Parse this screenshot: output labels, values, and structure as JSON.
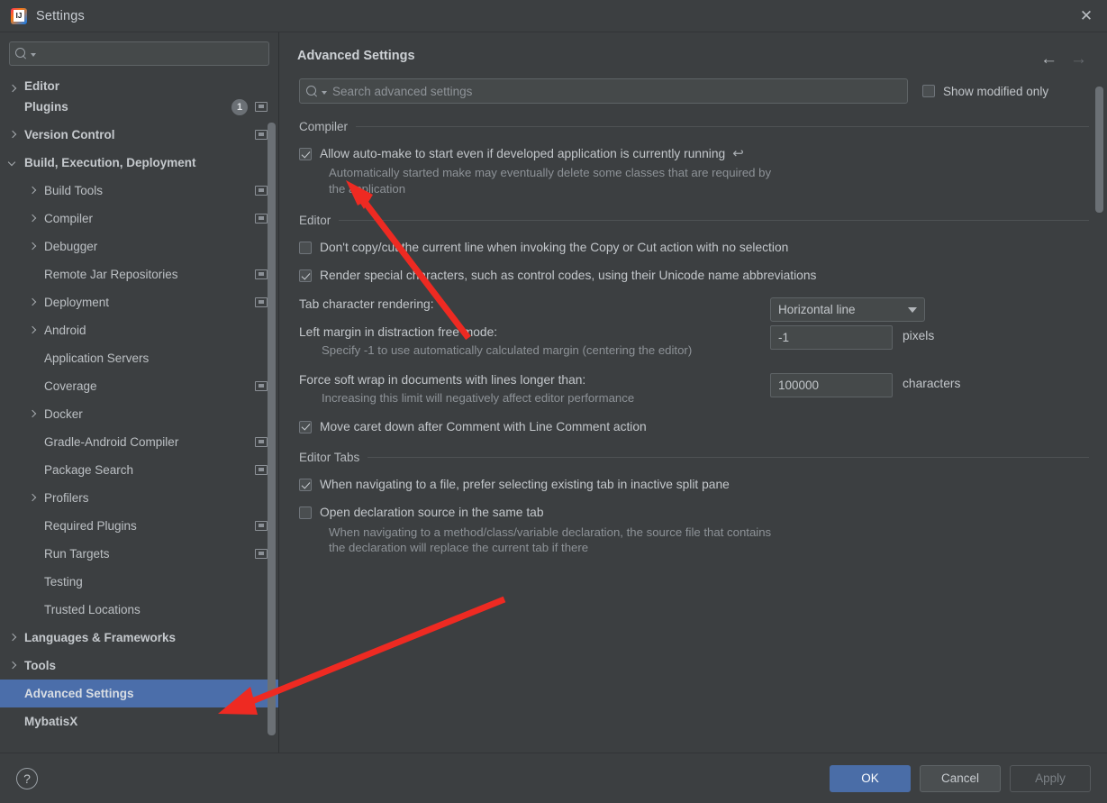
{
  "window": {
    "title": "Settings",
    "app_icon": "intellij-idea-icon",
    "close_icon": "close-icon"
  },
  "sidebar": {
    "search": {
      "placeholder": "",
      "value": "",
      "icon": "search-icon"
    },
    "items": [
      {
        "label": "Editor",
        "arrow": "right",
        "bold": true,
        "clipped": true,
        "badge": "",
        "proj_icon": false,
        "selected": false
      },
      {
        "label": "Plugins",
        "arrow": "none",
        "bold": true,
        "clipped": false,
        "badge": "1",
        "proj_icon": true,
        "selected": false
      },
      {
        "label": "Version Control",
        "arrow": "right",
        "bold": true,
        "clipped": false,
        "badge": "",
        "proj_icon": true,
        "selected": false
      },
      {
        "label": "Build, Execution, Deployment",
        "arrow": "down",
        "bold": true,
        "clipped": false,
        "badge": "",
        "proj_icon": false,
        "selected": false
      },
      {
        "label": "Build Tools",
        "arrow": "right",
        "bold": false,
        "clipped": false,
        "badge": "",
        "proj_icon": true,
        "selected": false,
        "indent": 1
      },
      {
        "label": "Compiler",
        "arrow": "right",
        "bold": false,
        "clipped": false,
        "badge": "",
        "proj_icon": true,
        "selected": false,
        "indent": 1
      },
      {
        "label": "Debugger",
        "arrow": "right",
        "bold": false,
        "clipped": false,
        "badge": "",
        "proj_icon": false,
        "selected": false,
        "indent": 1
      },
      {
        "label": "Remote Jar Repositories",
        "arrow": "none",
        "bold": false,
        "clipped": false,
        "badge": "",
        "proj_icon": true,
        "selected": false,
        "indent": 1
      },
      {
        "label": "Deployment",
        "arrow": "right",
        "bold": false,
        "clipped": false,
        "badge": "",
        "proj_icon": true,
        "selected": false,
        "indent": 1
      },
      {
        "label": "Android",
        "arrow": "right",
        "bold": false,
        "clipped": false,
        "badge": "",
        "proj_icon": false,
        "selected": false,
        "indent": 1
      },
      {
        "label": "Application Servers",
        "arrow": "none",
        "bold": false,
        "clipped": false,
        "badge": "",
        "proj_icon": false,
        "selected": false,
        "indent": 1
      },
      {
        "label": "Coverage",
        "arrow": "none",
        "bold": false,
        "clipped": false,
        "badge": "",
        "proj_icon": true,
        "selected": false,
        "indent": 1
      },
      {
        "label": "Docker",
        "arrow": "right",
        "bold": false,
        "clipped": false,
        "badge": "",
        "proj_icon": false,
        "selected": false,
        "indent": 1
      },
      {
        "label": "Gradle-Android Compiler",
        "arrow": "none",
        "bold": false,
        "clipped": false,
        "badge": "",
        "proj_icon": true,
        "selected": false,
        "indent": 1
      },
      {
        "label": "Package Search",
        "arrow": "none",
        "bold": false,
        "clipped": false,
        "badge": "",
        "proj_icon": true,
        "selected": false,
        "indent": 1
      },
      {
        "label": "Profilers",
        "arrow": "right",
        "bold": false,
        "clipped": false,
        "badge": "",
        "proj_icon": false,
        "selected": false,
        "indent": 1
      },
      {
        "label": "Required Plugins",
        "arrow": "none",
        "bold": false,
        "clipped": false,
        "badge": "",
        "proj_icon": true,
        "selected": false,
        "indent": 1
      },
      {
        "label": "Run Targets",
        "arrow": "none",
        "bold": false,
        "clipped": false,
        "badge": "",
        "proj_icon": true,
        "selected": false,
        "indent": 1
      },
      {
        "label": "Testing",
        "arrow": "none",
        "bold": false,
        "clipped": false,
        "badge": "",
        "proj_icon": false,
        "selected": false,
        "indent": 1
      },
      {
        "label": "Trusted Locations",
        "arrow": "none",
        "bold": false,
        "clipped": false,
        "badge": "",
        "proj_icon": false,
        "selected": false,
        "indent": 1
      },
      {
        "label": "Languages & Frameworks",
        "arrow": "right",
        "bold": true,
        "clipped": false,
        "badge": "",
        "proj_icon": false,
        "selected": false
      },
      {
        "label": "Tools",
        "arrow": "right",
        "bold": true,
        "clipped": false,
        "badge": "",
        "proj_icon": false,
        "selected": false
      },
      {
        "label": "Advanced Settings",
        "arrow": "none",
        "bold": true,
        "clipped": false,
        "badge": "",
        "proj_icon": false,
        "selected": true
      },
      {
        "label": "MybatisX",
        "arrow": "none",
        "bold": true,
        "clipped": false,
        "badge": "",
        "proj_icon": false,
        "selected": false
      }
    ]
  },
  "main": {
    "page_title": "Advanced Settings",
    "nav_back_icon": "arrow-left-icon",
    "nav_forward_icon": "arrow-right-icon",
    "search": {
      "placeholder": "Search advanced settings",
      "value": "",
      "icon": "search-icon"
    },
    "show_modified_only": {
      "label": "Show modified only",
      "checked": false
    },
    "sections": [
      {
        "title": "Compiler",
        "rows": [
          {
            "kind": "checkbox",
            "label": "Allow auto-make to start even if developed application is currently running",
            "checked": true,
            "revert_icon": "revert-icon",
            "description": "Automatically started make may eventually delete some classes that are required by the application"
          }
        ]
      },
      {
        "title": "Editor",
        "rows": [
          {
            "kind": "checkbox",
            "label": "Don't copy/cut the current line when invoking the Copy or Cut action with no selection",
            "checked": false,
            "revert_icon": "",
            "description": ""
          },
          {
            "kind": "checkbox",
            "label": "Render special characters, such as control codes, using their Unicode name abbreviations",
            "checked": true,
            "revert_icon": "",
            "description": ""
          },
          {
            "kind": "combo",
            "label": "Tab character rendering:",
            "value": "Horizontal line",
            "unit": "",
            "description": ""
          },
          {
            "kind": "text",
            "label": "Left margin in distraction free mode:",
            "value": "-1",
            "unit": "pixels",
            "description": "Specify -1 to use automatically calculated margin (centering the editor)"
          },
          {
            "kind": "text",
            "label": "Force soft wrap in documents with lines longer than:",
            "value": "100000",
            "unit": "characters",
            "description": "Increasing this limit will negatively affect editor performance"
          },
          {
            "kind": "checkbox",
            "label": "Move caret down after Comment with Line Comment action",
            "checked": true,
            "revert_icon": "",
            "description": ""
          }
        ]
      },
      {
        "title": "Editor Tabs",
        "rows": [
          {
            "kind": "checkbox",
            "label": "When navigating to a file, prefer selecting existing tab in inactive split pane",
            "checked": true,
            "revert_icon": "",
            "description": ""
          },
          {
            "kind": "checkbox",
            "label": "Open declaration source in the same tab",
            "checked": false,
            "revert_icon": "",
            "description": "When navigating to a method/class/variable declaration, the source file that contains the declaration will replace the current tab if there"
          }
        ]
      }
    ]
  },
  "footer": {
    "help_label": "?",
    "ok_label": "OK",
    "cancel_label": "Cancel",
    "apply_label": "Apply"
  },
  "colors": {
    "background": "#3c3f41",
    "selection_blue": "#4b6eaa",
    "primary_button": "#4a6da7",
    "annotation_red": "#ee2a22",
    "text": "#c3c7cb",
    "muted_text": "#8d9297"
  }
}
